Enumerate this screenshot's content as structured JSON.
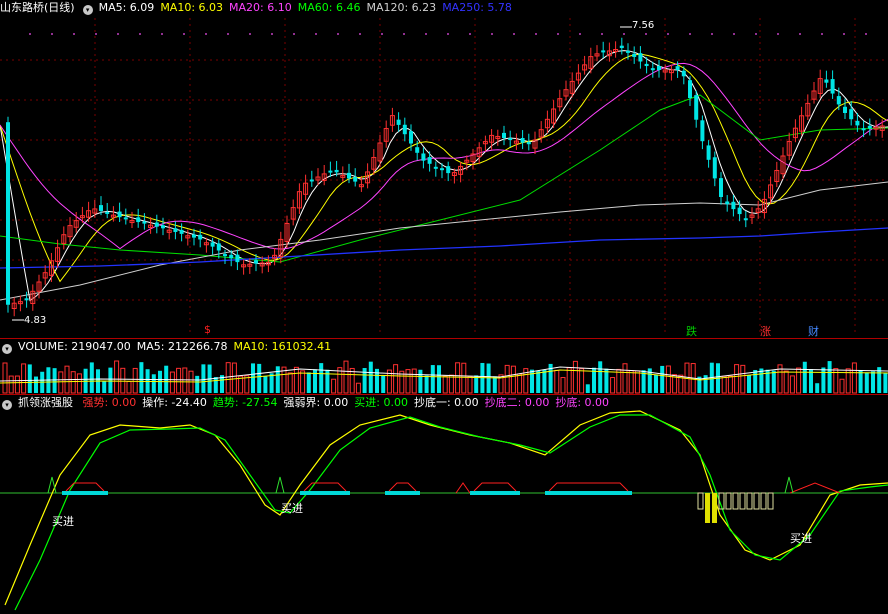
{
  "main_panel": {
    "title": "山东路桥(日线)",
    "indicators": [
      {
        "label": "MA5: 6.09",
        "color": "#ffffff"
      },
      {
        "label": "MA10: 6.03",
        "color": "#ffff00"
      },
      {
        "label": "MA20: 6.10",
        "color": "#ff44ff"
      },
      {
        "label": "MA60: 6.46",
        "color": "#00ff00"
      },
      {
        "label": "MA120: 6.23",
        "color": "#d0d0d0"
      },
      {
        "label": "MA250: 5.78",
        "color": "#3333ff"
      }
    ],
    "high_label": "7.56",
    "low_label": "4.83",
    "markers": [
      {
        "text": "$",
        "color": "#ff2020"
      },
      {
        "text": "跌",
        "color": "#00cc00"
      },
      {
        "text": "涨",
        "color": "#ff3030"
      },
      {
        "text": "财",
        "color": "#4488ff"
      }
    ]
  },
  "volume_panel": {
    "indicators": [
      {
        "label": "VOLUME: 219047.00",
        "color": "#ffffff"
      },
      {
        "label": "MA5: 212266.78",
        "color": "#ffffff"
      },
      {
        "label": "MA10: 161032.41",
        "color": "#ffff00"
      }
    ]
  },
  "indicator_panel": {
    "title": "抓领涨强股",
    "indicators": [
      {
        "label": "强势: 0.00",
        "color": "#ff3030"
      },
      {
        "label": "操作: -24.40",
        "color": "#ffffff"
      },
      {
        "label": "趋势: -27.54",
        "color": "#00ff00"
      },
      {
        "label": "强弱界: 0.00",
        "color": "#ffffff"
      },
      {
        "label": "买进: 0.00",
        "color": "#00ff00"
      },
      {
        "label": "抄底一: 0.00",
        "color": "#ffffff"
      },
      {
        "label": "抄底二: 0.00",
        "color": "#ff44ff"
      },
      {
        "label": "抄底: 0.00",
        "color": "#ff44ff"
      }
    ],
    "buy_labels": [
      "买进",
      "买进",
      "买进"
    ]
  },
  "colors": {
    "up": "#ff3030",
    "down": "#00e5e5",
    "grid": "#7a0000",
    "panel_border": "#b00000"
  }
}
